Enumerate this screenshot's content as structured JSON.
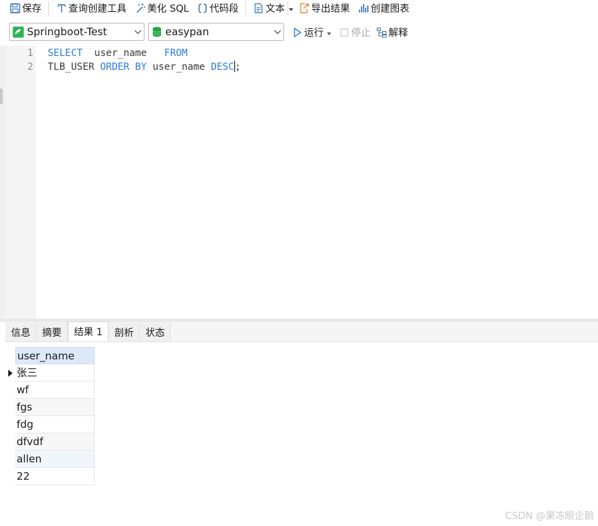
{
  "toolbar": {
    "save_label": "保存",
    "query_builder_label": "查询创建工具",
    "beautify_label": "美化 SQL",
    "snippet_label": "代码段",
    "text_label": "文本",
    "export_label": "导出结果",
    "create_chart_label": "创建图表"
  },
  "connection": {
    "name": "Springboot-Test",
    "database": "easypan"
  },
  "run_controls": {
    "run_label": "运行",
    "stop_label": "停止",
    "explain_label": "解释"
  },
  "editor": {
    "line_numbers": [
      "1",
      "2"
    ],
    "line1": {
      "kw1": "SELECT",
      "id1": "  user_name   ",
      "kw2": "FROM"
    },
    "line2": {
      "id1": "TLB_USER ",
      "kw1": "ORDER BY",
      "id2": " user_name ",
      "kw2": "DESC",
      "end": ";"
    }
  },
  "result_tabs": [
    "信息",
    "摘要",
    "结果 1",
    "剖析",
    "状态"
  ],
  "active_tab": "结果 1",
  "result_grid": {
    "columns": [
      "user_name"
    ],
    "rows": [
      "张三",
      "wf",
      "fgs",
      "fdg",
      "dfvdf",
      "allen",
      "22"
    ]
  },
  "watermark": "CSDN @果冻眼企鹅",
  "colors": {
    "keyword": "#2a7ad8",
    "header_bg": "#dbe9f8",
    "connection_icon": "#2eb352",
    "database_icon": "#22a845",
    "run_icon": "#2f7fd8"
  },
  "icons": {
    "save": "save-icon",
    "query_builder": "query-builder-icon",
    "beautify": "magic-wand-icon",
    "snippet": "braces-icon",
    "text": "document-icon",
    "export": "export-icon",
    "chart": "chart-icon",
    "connection": "connection-icon",
    "database": "database-icon",
    "run": "play-icon",
    "stop": "stop-icon",
    "explain": "explain-icon"
  }
}
